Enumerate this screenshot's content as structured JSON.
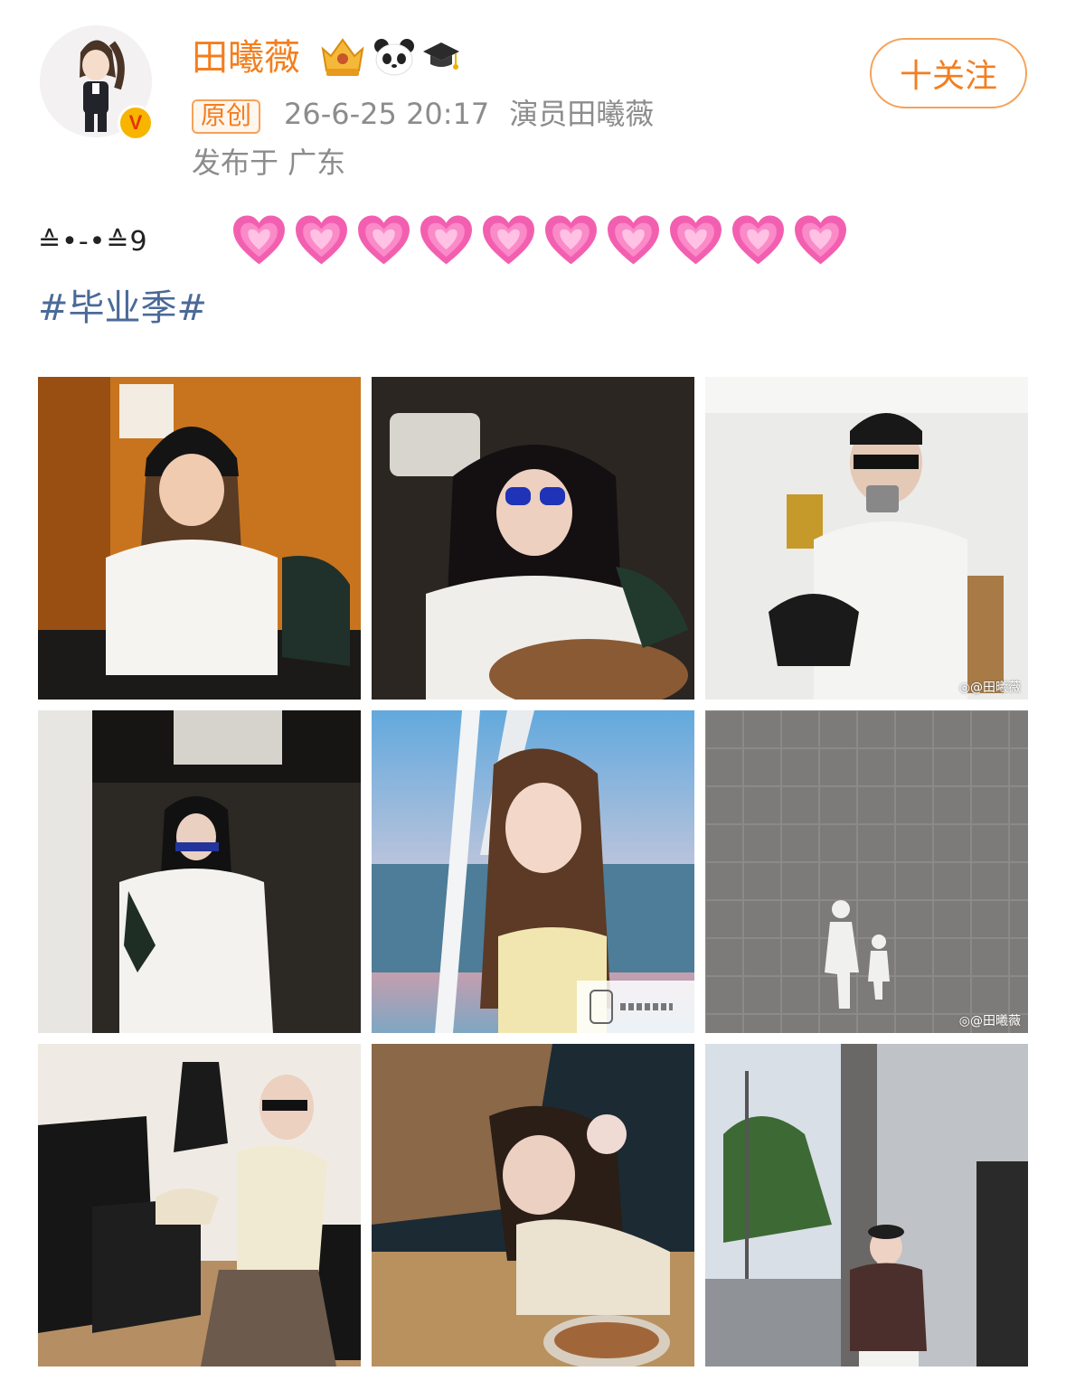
{
  "user": {
    "name": "田曦薇",
    "verified_mark": "V",
    "follow_label": "十关注"
  },
  "post": {
    "original_tag": "原创",
    "timestamp": "26-6-25 20:17",
    "source": "演员田曦薇",
    "location": "发布于 广东",
    "kaomoji": "≙•-•≙9",
    "heart_count": 10,
    "hashtag": "#毕业季#"
  },
  "photos": [
    {
      "name": "photo-1",
      "watermark": ""
    },
    {
      "name": "photo-2",
      "watermark": ""
    },
    {
      "name": "photo-3",
      "watermark": "◎@田曦薇"
    },
    {
      "name": "photo-4",
      "watermark": ""
    },
    {
      "name": "photo-5",
      "watermark": ""
    },
    {
      "name": "photo-6",
      "watermark": "◎@田曦薇"
    },
    {
      "name": "photo-7",
      "watermark": ""
    },
    {
      "name": "photo-8",
      "watermark": ""
    },
    {
      "name": "photo-9",
      "watermark": ""
    }
  ],
  "colors": {
    "accent": "#f47e1e",
    "hashtag": "#4a6a98",
    "meta": "#8c8c8c",
    "heart": "#f35fb0"
  },
  "icons": [
    "crown-icon",
    "panda-icon",
    "graduation-cap-icon",
    "heart-icon",
    "verified-v-icon",
    "live-photo-icon"
  ]
}
